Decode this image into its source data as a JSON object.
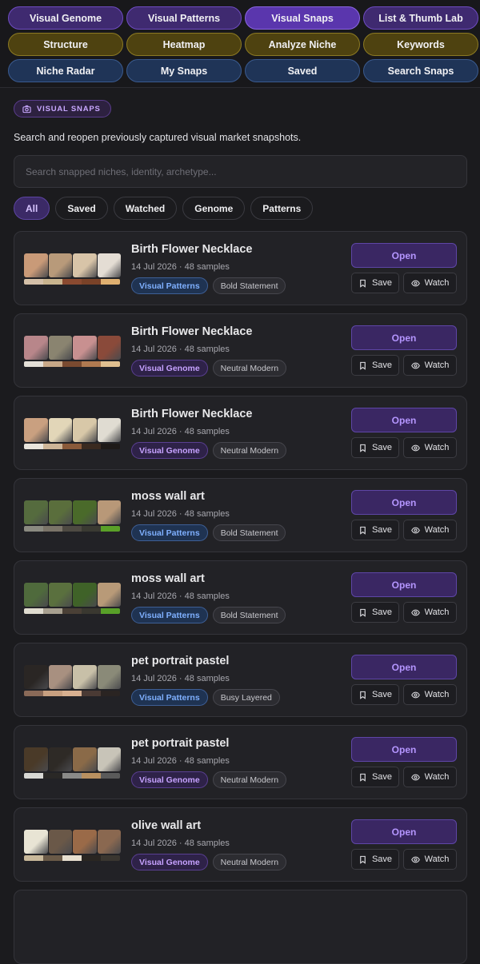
{
  "nav": {
    "buttons": [
      {
        "label": "Visual Genome",
        "color": "purple",
        "active": false
      },
      {
        "label": "Visual Patterns",
        "color": "purple",
        "active": false
      },
      {
        "label": "Visual Snaps",
        "color": "purple",
        "active": true
      },
      {
        "label": "List & Thumb Lab",
        "color": "purple",
        "active": false
      },
      {
        "label": "Structure",
        "color": "olive",
        "active": false
      },
      {
        "label": "Heatmap",
        "color": "olive",
        "active": false
      },
      {
        "label": "Analyze Niche",
        "color": "olive",
        "active": false
      },
      {
        "label": "Keywords",
        "color": "olive",
        "active": false
      },
      {
        "label": "Niche Radar",
        "color": "blue",
        "active": false
      },
      {
        "label": "My Snaps",
        "color": "blue",
        "active": false
      },
      {
        "label": "Saved",
        "color": "blue",
        "active": false
      },
      {
        "label": "Search Snaps",
        "color": "blue",
        "active": false
      }
    ]
  },
  "section": {
    "badge": "VISUAL SNAPS",
    "badge_icon": "camera-icon",
    "subtitle": "Search and reopen previously captured visual market snapshots."
  },
  "search": {
    "placeholder": "Search snapped niches, identity, archetype...",
    "value": ""
  },
  "filters": [
    {
      "label": "All",
      "active": true
    },
    {
      "label": "Saved",
      "active": false
    },
    {
      "label": "Watched",
      "active": false
    },
    {
      "label": "Genome",
      "active": false
    },
    {
      "label": "Patterns",
      "active": false
    }
  ],
  "actions": {
    "open": "Open",
    "save": "Save",
    "watch": "Watch"
  },
  "snaps": [
    {
      "title": "Birth Flower Necklace",
      "meta": "14 Jul 2026 · 48 samples",
      "source": "Visual Patterns",
      "source_type": "patterns",
      "style": "Bold Statement",
      "thumbs": [
        "#c99a78",
        "#b89a7a",
        "#d8c4a8",
        "#e4ddd4"
      ],
      "palette": [
        "#d4c0a8",
        "#c9b48e",
        "#8a4a30",
        "#7a4228",
        "#e0b070"
      ]
    },
    {
      "title": "Birth Flower Necklace",
      "meta": "14 Jul 2026 · 48 samples",
      "source": "Visual Genome",
      "source_type": "genome",
      "style": "Neutral Modern",
      "thumbs": [
        "#b8868a",
        "#8a8470",
        "#c89090",
        "#8a4a3a"
      ],
      "palette": [
        "#e4e0d8",
        "#c8a888",
        "#7a4a30",
        "#b07a50",
        "#e0c090"
      ]
    },
    {
      "title": "Birth Flower Necklace",
      "meta": "14 Jul 2026 · 48 samples",
      "source": "Visual Genome",
      "source_type": "genome",
      "style": "Neutral Modern",
      "thumbs": [
        "#c9a080",
        "#e2d6b8",
        "#d8c8a8",
        "#e0dcd2"
      ],
      "palette": [
        "#e8e4dc",
        "#cdb598",
        "#8a5a3a",
        "#3a2a20",
        "#1e1a18"
      ]
    },
    {
      "title": "moss wall art",
      "meta": "14 Jul 2026 · 48 samples",
      "source": "Visual Patterns",
      "source_type": "patterns",
      "style": "Bold Statement",
      "thumbs": [
        "#556b3e",
        "#5a6e3c",
        "#4a6a2a",
        "#b89878"
      ],
      "palette": [
        "#8a8a80",
        "#7a7468",
        "#4e4a42",
        "#3a3a32",
        "#5aa028"
      ]
    },
    {
      "title": "moss wall art",
      "meta": "14 Jul 2026 · 48 samples",
      "source": "Visual Patterns",
      "source_type": "patterns",
      "style": "Bold Statement",
      "thumbs": [
        "#4f6a3c",
        "#5a703e",
        "#3f6228",
        "#b89a78"
      ],
      "palette": [
        "#e0dcd0",
        "#a8a090",
        "#4a4036",
        "#3a3830",
        "#58a028"
      ]
    },
    {
      "title": "pet portrait pastel",
      "meta": "14 Jul 2026 · 48 samples",
      "source": "Visual Patterns",
      "source_type": "patterns",
      "style": "Busy Layered",
      "thumbs": [
        "#2a2624",
        "#a89080",
        "#c8c0a8",
        "#8a8a78"
      ],
      "palette": [
        "#8a6a58",
        "#c8a080",
        "#d8b090",
        "#4a3a34",
        "#2a2422"
      ]
    },
    {
      "title": "pet portrait pastel",
      "meta": "14 Jul 2026 · 48 samples",
      "source": "Visual Genome",
      "source_type": "genome",
      "style": "Neutral Modern",
      "thumbs": [
        "#4a3a28",
        "#2e2a26",
        "#8a6a48",
        "#c8c4b8"
      ],
      "palette": [
        "#d8d8d4",
        "#2a2826",
        "#8a8a88",
        "#b89060",
        "#5a5a5a"
      ]
    },
    {
      "title": "olive wall art",
      "meta": "14 Jul 2026 · 48 samples",
      "source": "Visual Genome",
      "source_type": "genome",
      "style": "Neutral Modern",
      "thumbs": [
        "#e8e4d4",
        "#6a5848",
        "#9a6a48",
        "#8a6850"
      ],
      "palette": [
        "#c8b89a",
        "#6a5a48",
        "#e8e0d0",
        "#2a2622",
        "#3a3630"
      ]
    }
  ]
}
